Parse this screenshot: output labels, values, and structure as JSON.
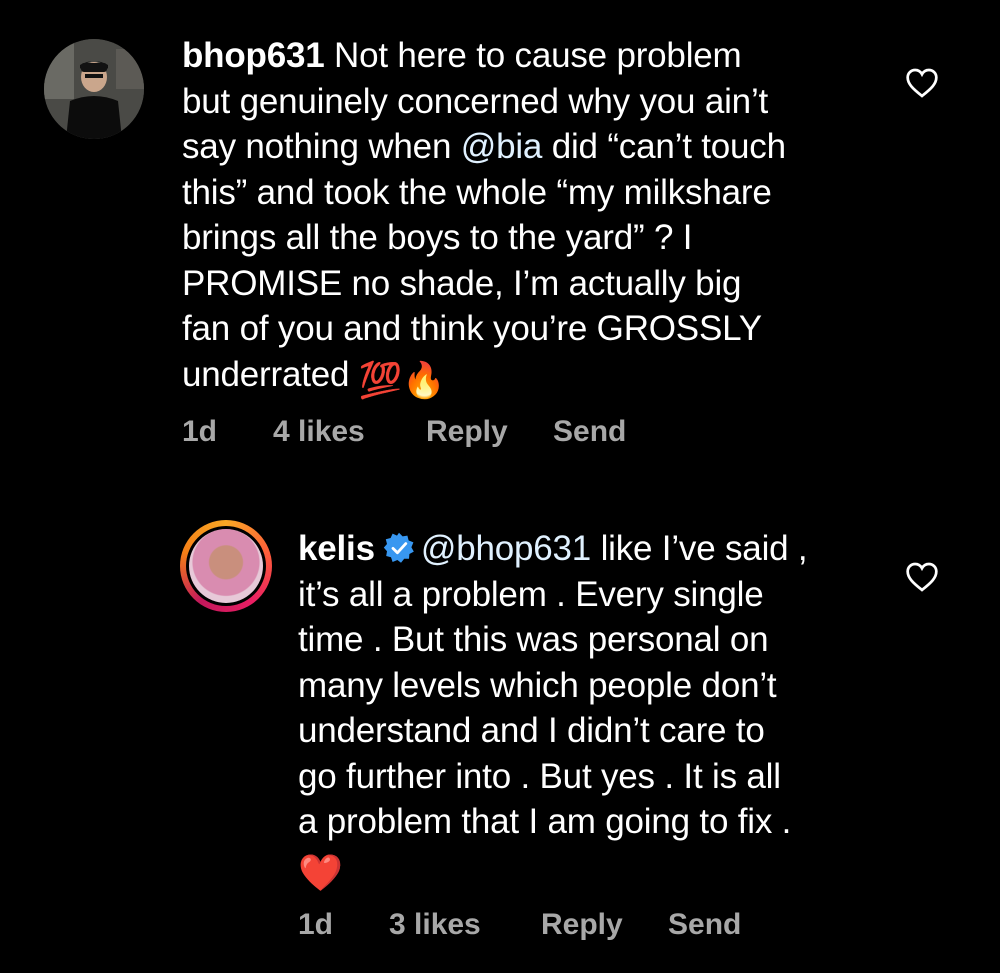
{
  "comments": [
    {
      "username": "bhop631",
      "lines": [
        "Not here to cause problem",
        "but genuinely concerned why you ain’t",
        "say nothing when ",
        "@bia",
        " did “can’t touch",
        "this” and took the whole “my milkshare",
        "brings all the boys to the yard” ? I",
        "PROMISE no shade, I’m actually big",
        "fan of you and think you’re GROSSLY",
        "underrated "
      ],
      "emoji_100": "💯",
      "emoji_fire": "🔥",
      "time": "1d",
      "likes": "4 likes",
      "reply": "Reply",
      "send": "Send"
    },
    {
      "username": "kelis",
      "mention": "@bhop631",
      "lines": [
        " like I’ve said ,",
        "it’s all a problem . Every single",
        "time . But this was personal on",
        "many levels which people don’t",
        "understand and I didn’t care to",
        "go further into . But yes . It is all",
        "a problem that I am going to fix ."
      ],
      "emoji_heart": "❤️",
      "time": "1d",
      "likes": "3 likes",
      "reply": "Reply",
      "send": "Send"
    }
  ],
  "colors": {
    "background": "#000000",
    "text": "#ffffff",
    "meta": "#a8a8a8",
    "mention": "#e0f1ff",
    "verified": "#3897f0"
  }
}
